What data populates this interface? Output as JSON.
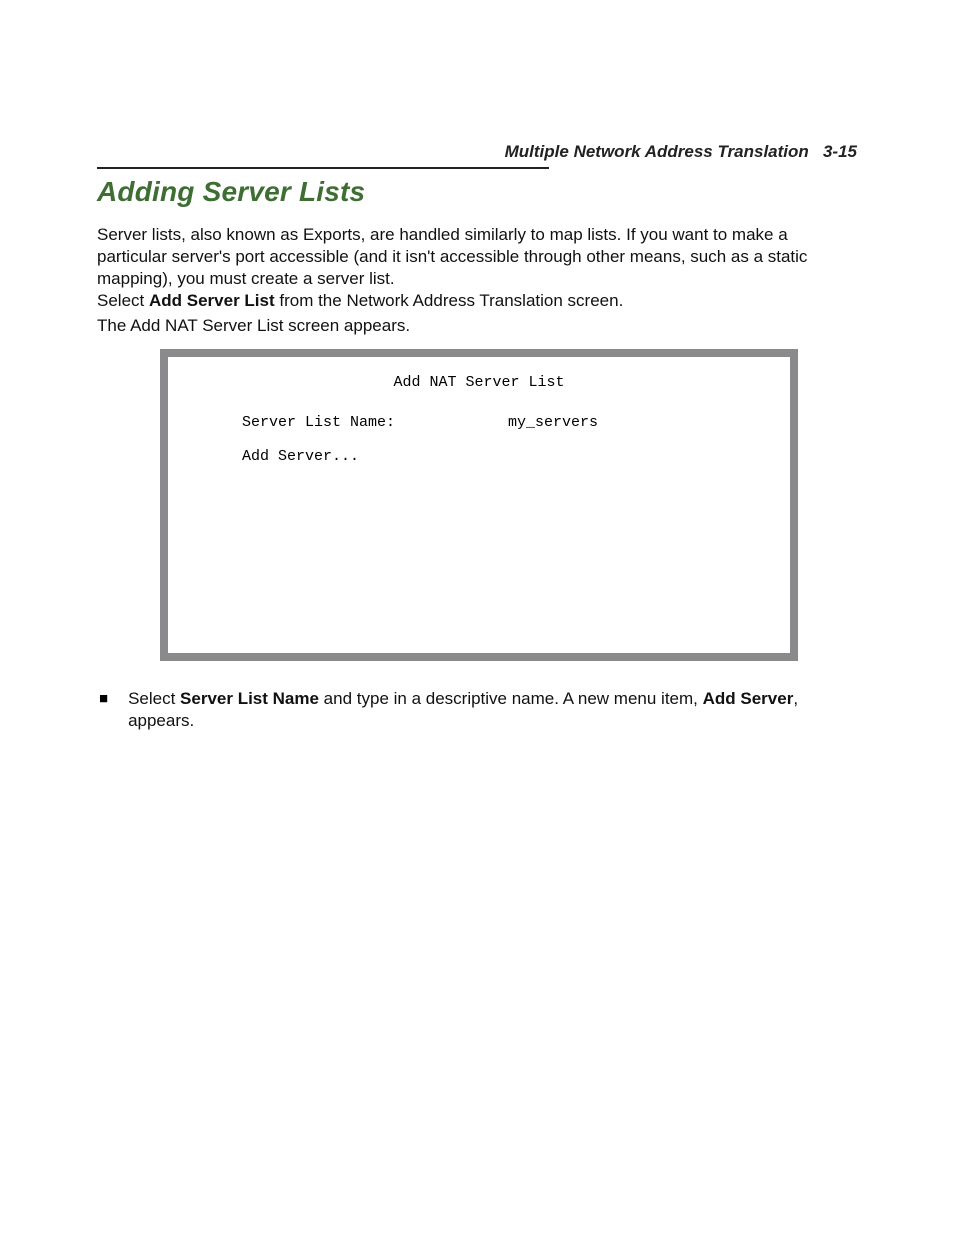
{
  "header": {
    "title": "Multiple Network Address Translation",
    "page_number": "3-15"
  },
  "section": {
    "heading": "Adding Server Lists"
  },
  "body": {
    "para1": "Server lists, also known as Exports, are handled similarly to map lists. If you want to make a particular server's port accessible (and it isn't accessible through other means, such as a static mapping), you must create a server list.",
    "para2_pre": "Select ",
    "para2_bold": "Add Server List",
    "para2_post": " from the Network Address Translation screen.",
    "para3": "The Add NAT Server List screen appears."
  },
  "terminal": {
    "title": "Add NAT Server List",
    "field_label": "Server List Name:",
    "field_value": "my_servers",
    "add_item": "Add Server..."
  },
  "bullet": {
    "pre": "Select ",
    "bold1": "Server List Name",
    "mid": " and type in a descriptive name. A new menu item, ",
    "bold2": "Add Server",
    "post": ", appears."
  }
}
